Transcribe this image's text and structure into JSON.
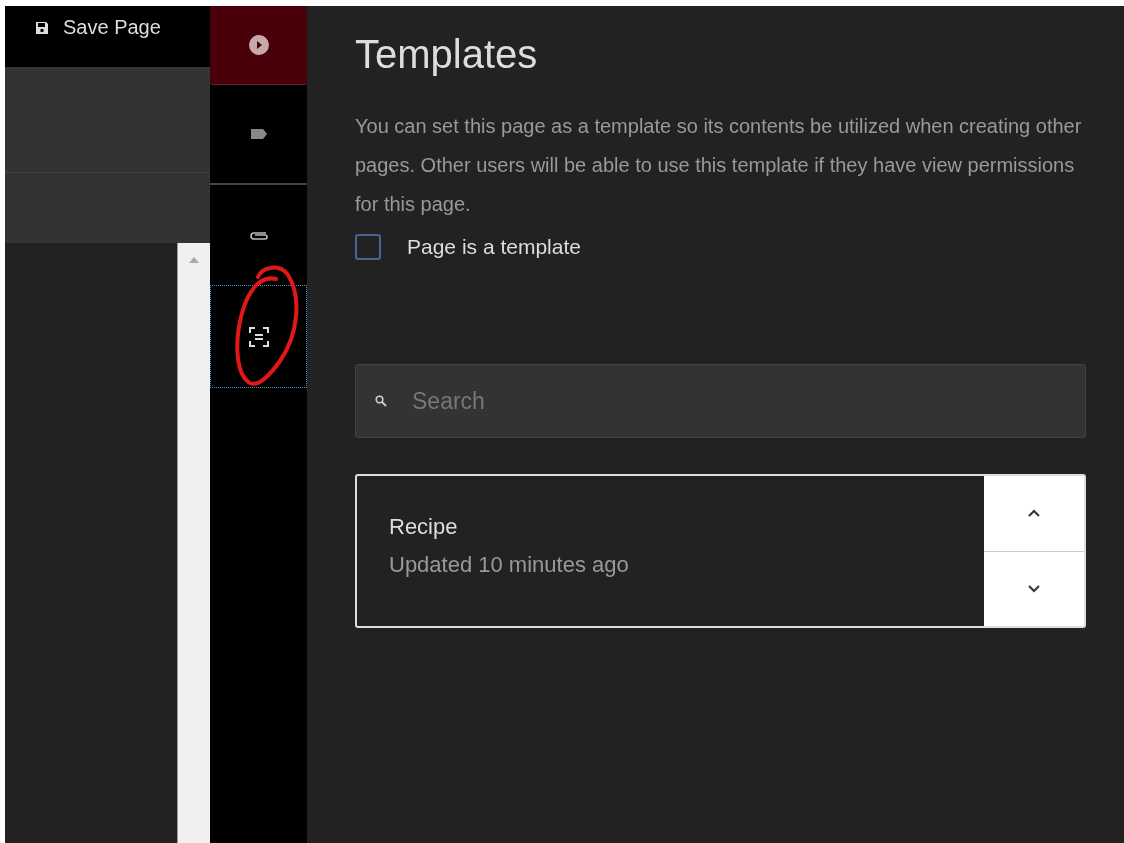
{
  "editor": {
    "save_button": "Save Page"
  },
  "toolbar": [
    {
      "kind": "play",
      "selected": true
    },
    {
      "kind": "tag",
      "selected": false
    },
    {
      "kind": "attachment",
      "selected": false
    },
    {
      "kind": "template",
      "selected": false,
      "focused": true
    }
  ],
  "panel": {
    "title": "Templates",
    "description": "You can set this page as a template so its contents be utilized when creating other pages. Other users will be able to use this template if they have view permissions for this page.",
    "checkbox": {
      "label": "Page is a template",
      "checked": false
    },
    "search": {
      "placeholder": "Search"
    },
    "templates": [
      {
        "name": "Recipe",
        "updated": "Updated 10 minutes ago"
      }
    ]
  }
}
